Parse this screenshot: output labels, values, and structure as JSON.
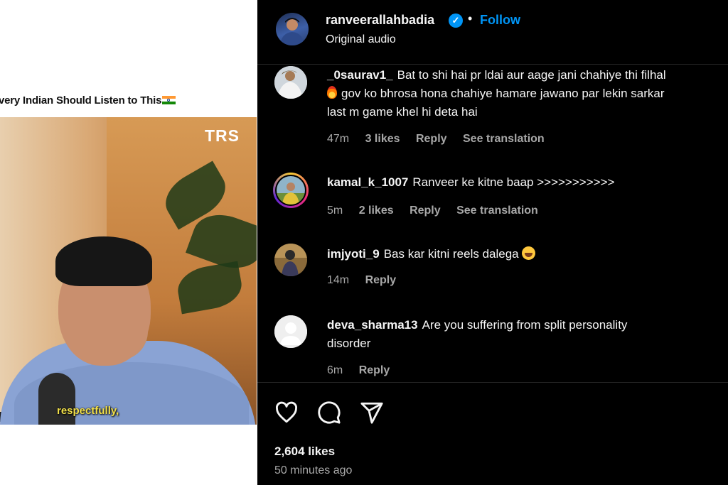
{
  "reel": {
    "title": "very Indian Should Listen to This",
    "watermark": "TRS",
    "caption": "respectfully,"
  },
  "post": {
    "owner_username": "ranveerallahbadia",
    "verified_mark": "✓",
    "separator": "•",
    "follow_label": "Follow",
    "audio": "Original audio"
  },
  "comments": [
    {
      "username": "_0saurav1_",
      "text_line1": "Bat to shi hai pr ldai aur aage jani chahiye thi filhal",
      "text_line2": "gov ko bhrosa hona chahiye hamare jawano par lekin sarkar",
      "text_line3": "last m game khel hi deta hai",
      "time": "47m",
      "likes": "3 likes",
      "reply": "Reply",
      "translation": "See translation"
    },
    {
      "username": "kamal_k_1007",
      "text": "Ranveer ke kitne baap >>>>>>>>>>>",
      "time": "5m",
      "likes": "2 likes",
      "reply": "Reply",
      "translation": "See translation"
    },
    {
      "username": "imjyoti_9",
      "text": "Bas kar kitni reels dalega",
      "time": "14m",
      "reply": "Reply"
    },
    {
      "username": "deva_sharma13",
      "text_line1": "Are you suffering from split personality",
      "text_line2": "disorder",
      "time": "6m",
      "reply": "Reply"
    }
  ],
  "footer": {
    "likes": "2,604 likes",
    "time_ago": "50 minutes ago"
  },
  "colors": {
    "accent": "#0095f6",
    "background": "#000000",
    "muted_text": "#a8a8a8",
    "story_ring": "#d62976"
  },
  "icons": [
    "heart-icon",
    "comment-icon",
    "share-icon",
    "verified-icon"
  ]
}
